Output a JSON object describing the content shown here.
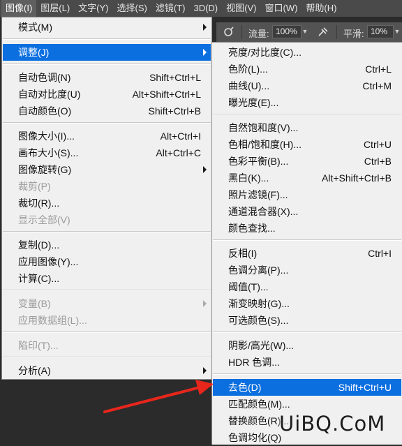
{
  "menubar": {
    "items": [
      "图像(I)",
      "图层(L)",
      "文字(Y)",
      "选择(S)",
      "滤镜(T)",
      "3D(D)",
      "视图(V)",
      "窗口(W)",
      "帮助(H)"
    ]
  },
  "options_bar": {
    "flow_label": "流量:",
    "flow_value": "100%",
    "smooth_label": "平滑:",
    "smooth_value": "10%"
  },
  "image_menu": [
    {
      "label": "模式(M)",
      "shortcut": "",
      "submenu": true
    },
    {
      "label": "调整(J)",
      "shortcut": "",
      "submenu": true,
      "highlighted": true
    },
    {
      "label": "自动色调(N)",
      "shortcut": "Shift+Ctrl+L"
    },
    {
      "label": "自动对比度(U)",
      "shortcut": "Alt+Shift+Ctrl+L"
    },
    {
      "label": "自动颜色(O)",
      "shortcut": "Shift+Ctrl+B"
    },
    {
      "label": "图像大小(I)...",
      "shortcut": "Alt+Ctrl+I"
    },
    {
      "label": "画布大小(S)...",
      "shortcut": "Alt+Ctrl+C"
    },
    {
      "label": "图像旋转(G)",
      "shortcut": "",
      "submenu": true
    },
    {
      "label": "裁剪(P)",
      "shortcut": "",
      "disabled": true
    },
    {
      "label": "裁切(R)...",
      "shortcut": ""
    },
    {
      "label": "显示全部(V)",
      "shortcut": "",
      "disabled": true
    },
    {
      "label": "复制(D)...",
      "shortcut": ""
    },
    {
      "label": "应用图像(Y)...",
      "shortcut": ""
    },
    {
      "label": "计算(C)...",
      "shortcut": ""
    },
    {
      "label": "变量(B)",
      "shortcut": "",
      "submenu": true,
      "disabled": true
    },
    {
      "label": "应用数据组(L)...",
      "shortcut": "",
      "disabled": true
    },
    {
      "label": "陷印(T)...",
      "shortcut": "",
      "disabled": true
    },
    {
      "label": "分析(A)",
      "shortcut": "",
      "submenu": true
    }
  ],
  "adjust_menu": [
    {
      "label": "亮度/对比度(C)...",
      "shortcut": ""
    },
    {
      "label": "色阶(L)...",
      "shortcut": "Ctrl+L"
    },
    {
      "label": "曲线(U)...",
      "shortcut": "Ctrl+M"
    },
    {
      "label": "曝光度(E)...",
      "shortcut": ""
    },
    {
      "label": "自然饱和度(V)...",
      "shortcut": ""
    },
    {
      "label": "色相/饱和度(H)...",
      "shortcut": "Ctrl+U"
    },
    {
      "label": "色彩平衡(B)...",
      "shortcut": "Ctrl+B"
    },
    {
      "label": "黑白(K)...",
      "shortcut": "Alt+Shift+Ctrl+B"
    },
    {
      "label": "照片滤镜(F)...",
      "shortcut": ""
    },
    {
      "label": "通道混合器(X)...",
      "shortcut": ""
    },
    {
      "label": "颜色查找...",
      "shortcut": ""
    },
    {
      "label": "反相(I)",
      "shortcut": "Ctrl+I"
    },
    {
      "label": "色调分离(P)...",
      "shortcut": ""
    },
    {
      "label": "阈值(T)...",
      "shortcut": ""
    },
    {
      "label": "渐变映射(G)...",
      "shortcut": ""
    },
    {
      "label": "可选颜色(S)...",
      "shortcut": ""
    },
    {
      "label": "阴影/高光(W)...",
      "shortcut": ""
    },
    {
      "label": "HDR 色调...",
      "shortcut": ""
    },
    {
      "label": "去色(D)",
      "shortcut": "Shift+Ctrl+U",
      "highlighted": true
    },
    {
      "label": "匹配颜色(M)...",
      "shortcut": ""
    },
    {
      "label": "替换颜色(R)...",
      "shortcut": ""
    },
    {
      "label": "色调均化(Q)",
      "shortcut": ""
    }
  ],
  "watermark": "UiBQ.CoM",
  "colors": {
    "menubar_bg": "#4a4a4a",
    "menu_bg": "#f0f0f0",
    "highlight": "#0c6fe0",
    "annotation_arrow": "#e8261c"
  }
}
